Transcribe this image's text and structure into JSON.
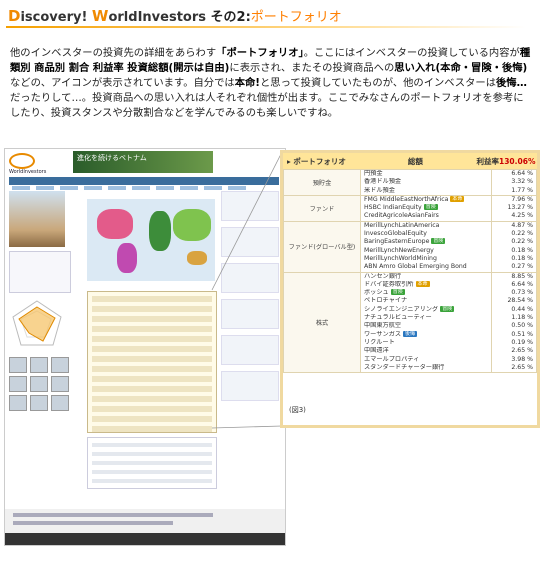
{
  "header": {
    "cap1": "D",
    "word1": "iscovery!",
    "cap2": "W",
    "word2": "orldInvestors",
    "part": "その2:",
    "title": "ポートフォリオ"
  },
  "intro": {
    "s1": "他のインベスターの投資先の詳細をあらわす",
    "b1": "「ポートフォリオ」",
    "s2": "。ここにはインベスターの投資している内容が",
    "b2": "種類別 商品別 割合 利益率 投資総額(開示は自由)",
    "s3": "に表示され、またその投資商品への",
    "b3": "思い入れ(本命・冒険・後悔)",
    "s4": "などの、アイコンが表示されています。自分では",
    "b4": "本命!",
    "s5": "と思って投資していたものが、他のインベスターは",
    "b5": "後悔…",
    "s6": "だったりして…。投資商品への思い入れは人それぞれ個性が出ます。ここでみなさんのポートフォリオを参考にしたり、投資スタンスや分散割合などを学んでみるのも楽しいですね。"
  },
  "site": {
    "logo_text": "WorldInvestors",
    "banner_text": "進化を続けるベトナム"
  },
  "portfolio": {
    "title": "ポートフォリオ",
    "total_label": "総額",
    "profit_label": "利益率",
    "profit_value": "130.06%",
    "figure_label": "(図3)",
    "badges": {
      "hon": "本命",
      "bou": "冒険",
      "kou": "後悔"
    },
    "groups": [
      {
        "category": "預貯金",
        "items": [
          {
            "name": "円預金",
            "value": "6.64 %"
          },
          {
            "name": "香港ドル預金",
            "value": "3.32 %"
          },
          {
            "name": "米ドル預金",
            "value": "1.77 %"
          }
        ]
      },
      {
        "category": "ファンド",
        "items": [
          {
            "name": "FMG MiddleEastNorthAfrica",
            "badge": "hon",
            "value": "7.96 %"
          },
          {
            "name": "HSBC IndianEquity",
            "badge": "bou",
            "value": "13.27 %"
          },
          {
            "name": "CreditAgricoleAsianFairs",
            "value": "4.25 %"
          }
        ]
      },
      {
        "category": "ファンド(グローバル型)",
        "items": [
          {
            "name": "MerillLynchLatinAmerica",
            "value": "4.87 %"
          },
          {
            "name": "InvescoGlobalEquity",
            "value": "0.22 %"
          },
          {
            "name": "BaringEasternEurope",
            "badge": "bou",
            "value": "0.22 %"
          },
          {
            "name": "MerillLynchNewEnergy",
            "value": "0.18 %"
          },
          {
            "name": "MerillLynchWorldMining",
            "value": "0.18 %"
          },
          {
            "name": "ABN Amro Global Emerging Bond",
            "value": "0.27 %"
          }
        ]
      },
      {
        "category": "株式",
        "items": [
          {
            "name": "ハンセン銀行",
            "value": "8.85 %"
          },
          {
            "name": "ドバイ証券取引所",
            "badge": "hon",
            "value": "6.64 %"
          },
          {
            "name": "ボッシュ",
            "badge": "bou",
            "value": "0.73 %"
          },
          {
            "name": "ペトロチャイナ",
            "value": "28.54 %"
          },
          {
            "name": "シノライエンジニアリング",
            "badge": "bou",
            "value": "0.44 %"
          },
          {
            "name": "ナチュラルビューティー",
            "value": "1.18 %"
          },
          {
            "name": "中国東方航空",
            "value": "0.50 %"
          },
          {
            "name": "ワーサンガス",
            "badge": "kou",
            "value": "0.51 %"
          },
          {
            "name": "リクルート",
            "value": "0.19 %"
          },
          {
            "name": "中国遠洋",
            "value": "2.65 %"
          },
          {
            "name": "エマールプロパティ",
            "value": "3.98 %"
          },
          {
            "name": "スタンダードチャーター銀行",
            "value": "2.65 %"
          }
        ]
      }
    ]
  },
  "colors": {
    "accent": "#f08a00",
    "panel_header": "#ffe599",
    "hon": "#e0a000",
    "bou": "#3aa33a",
    "kou": "#2a77c0"
  }
}
